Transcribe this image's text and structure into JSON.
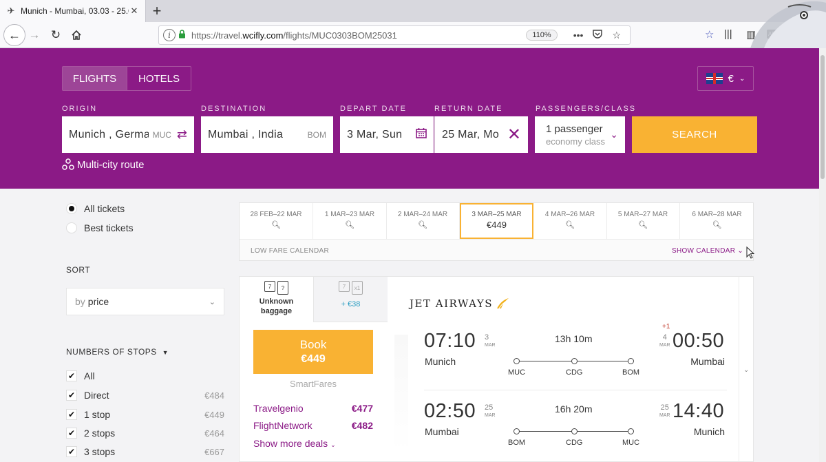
{
  "browser": {
    "tab_title": "Munich - Mumbai, 03.03 - 25.0",
    "url_prefix": "https://travel.",
    "url_domain": "wcifly.com",
    "url_path": "/flights/MUC0303BOM25031",
    "zoom": "110%"
  },
  "header": {
    "mode_tabs": [
      "FLIGHTS",
      "HOTELS"
    ],
    "currency": "€",
    "labels": {
      "origin": "ORIGIN",
      "destination": "DESTINATION",
      "depart": "DEPART DATE",
      "return": "RETURN DATE",
      "passengers": "PASSENGERS/CLASS"
    },
    "origin": {
      "value": "Munich , Germa",
      "code": "MUC"
    },
    "destination": {
      "value": "Mumbai , India",
      "code": "BOM"
    },
    "depart_date": "3 Mar, Sun",
    "return_date": "25 Mar, Mo",
    "passengers": "1 passenger",
    "class": "economy class",
    "search_label": "SEARCH",
    "multi_city": "Multi-city route"
  },
  "sidebar": {
    "ticket_filters": [
      {
        "label": "All tickets",
        "selected": true
      },
      {
        "label": "Best tickets",
        "selected": false
      }
    ],
    "sort_label": "SORT",
    "sort_prefix": "by",
    "sort_value": "price",
    "stops_label": "NUMBERS OF STOPS",
    "stops": [
      {
        "label": "All",
        "price": ""
      },
      {
        "label": "Direct",
        "price": "€484"
      },
      {
        "label": "1 stop",
        "price": "€449"
      },
      {
        "label": "2 stops",
        "price": "€464"
      },
      {
        "label": "3 stops",
        "price": "€667"
      }
    ]
  },
  "date_strip": {
    "cells": [
      {
        "label": "28 FEB–22 MAR",
        "price": ""
      },
      {
        "label": "1 MAR–23 MAR",
        "price": ""
      },
      {
        "label": "2 MAR–24 MAR",
        "price": ""
      },
      {
        "label": "3 MAR–25 MAR",
        "price": "€449"
      },
      {
        "label": "4 MAR–26 MAR",
        "price": ""
      },
      {
        "label": "5 MAR–27 MAR",
        "price": ""
      },
      {
        "label": "6 MAR–28 MAR",
        "price": ""
      }
    ],
    "active_index": 3,
    "low_fare": "LOW FARE CALENDAR",
    "show_calendar": "SHOW CALENDAR"
  },
  "result": {
    "baggage_unknown_line1": "Unknown",
    "baggage_unknown_line2": "baggage",
    "baggage_box1": "7",
    "baggage_box2": "?",
    "baggage_alt_box1": "7",
    "baggage_alt_box2": "x1",
    "baggage_add": "+ €38",
    "book_label": "Book",
    "book_price": "€449",
    "provider": "SmartFares",
    "deals": [
      {
        "name": "Travelgenio",
        "price": "€477"
      },
      {
        "name": "FlightNetwork",
        "price": "€482"
      }
    ],
    "more_deals": "Show more deals",
    "airline": "JET AIRWAYS",
    "legs": [
      {
        "dep_time": "07:10",
        "dep_day": "3",
        "dep_mon": "MAR",
        "dep_city": "Munich",
        "duration": "13h 10m",
        "plus_day": "+1",
        "arr_time": "00:50",
        "arr_day": "4",
        "arr_mon": "MAR",
        "arr_city": "Mumbai",
        "airports": [
          "MUC",
          "CDG",
          "BOM"
        ]
      },
      {
        "dep_time": "02:50",
        "dep_day": "25",
        "dep_mon": "MAR",
        "dep_city": "Mumbai",
        "duration": "16h 20m",
        "plus_day": "",
        "arr_time": "14:40",
        "arr_day": "25",
        "arr_mon": "MAR",
        "arr_city": "Munich",
        "airports": [
          "BOM",
          "CDG",
          "MUC"
        ]
      }
    ]
  }
}
